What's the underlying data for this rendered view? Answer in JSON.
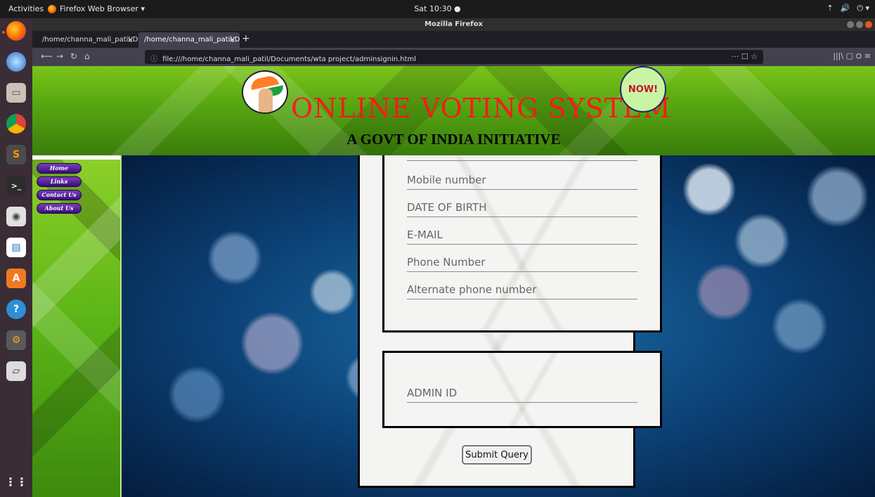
{
  "topbar": {
    "activities": "Activities",
    "app_menu": "Firefox Web Browser ▾",
    "clock": "Sat 10:30 ●",
    "tray": [
      "⇡",
      "🔊",
      "⏻ ▾"
    ]
  },
  "dock": {
    "items": [
      "firefox",
      "thunderbird",
      "files",
      "chrome",
      "sublime-text",
      "terminal",
      "disks",
      "writer",
      "software",
      "help",
      "settings",
      "scanner",
      "app-grid"
    ]
  },
  "window": {
    "title": "Mozilla Firefox"
  },
  "tabs": [
    {
      "label": "/home/channa_mali_patil/D",
      "active": false
    },
    {
      "label": "/home/channa_mali_patil/D",
      "active": true
    }
  ],
  "navbar": {
    "url": "file:///home/channa_mali_patil/Documents/wta project/adminsignin.html",
    "url_right": "··· ☐ ☆",
    "tools": "|||\\  ▢  ⛭  ≡"
  },
  "page": {
    "title": "ONLINE VOTING SYSTEM",
    "badge": "NOW!",
    "subtitle": "A GOVT OF INDIA INITIATIVE",
    "nav": [
      "Home",
      "Links",
      "Contact Us",
      "About Us"
    ],
    "fields": {
      "mobile": "Mobile number",
      "dob": "DATE OF BIRTH",
      "email": "E-MAIL",
      "phone": "Phone Number",
      "alt_phone": "Alternate phone number",
      "admin_id": "ADMIN ID"
    },
    "submit": "Submit Query"
  },
  "colors": {
    "title_red": "#ff1a1a",
    "header_green": "#55a511",
    "dock_bg": "#3a2d36",
    "nav_pill": "#5a1f9e"
  }
}
